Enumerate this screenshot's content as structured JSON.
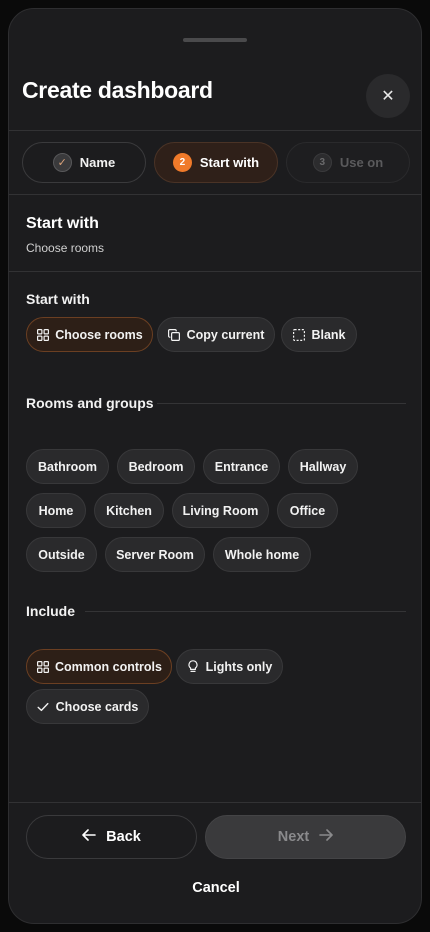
{
  "dialog": {
    "title": "Create dashboard",
    "close_icon": "close-icon"
  },
  "steps": [
    {
      "badge": "✓",
      "label": "Name",
      "state": "done"
    },
    {
      "badge": "2",
      "label": "Start with",
      "state": "active"
    },
    {
      "badge": "3",
      "label": "Use on",
      "state": "disabled"
    }
  ],
  "section": {
    "title": "Start with",
    "subtitle": "Choose rooms"
  },
  "start_with": {
    "label": "Start with",
    "options": [
      {
        "label": "Choose rooms",
        "icon": "grid-icon",
        "selected": true
      },
      {
        "label": "Copy current",
        "icon": "copy-icon",
        "selected": false
      },
      {
        "label": "Blank",
        "icon": "dashed-square-icon",
        "selected": false
      }
    ]
  },
  "rooms": {
    "label": "Rooms and groups",
    "items": [
      "Bathroom",
      "Bedroom",
      "Entrance",
      "Hallway",
      "Home",
      "Kitchen",
      "Living Room",
      "Office",
      "Outside",
      "Server Room",
      "Whole home"
    ]
  },
  "include": {
    "label": "Include",
    "options": [
      {
        "label": "Common controls",
        "icon": "grid-icon",
        "selected": true
      },
      {
        "label": "Lights only",
        "icon": "lightbulb-icon",
        "selected": false
      },
      {
        "label": "Choose cards",
        "icon": "check-icon",
        "selected": false
      }
    ]
  },
  "footer": {
    "back_label": "Back",
    "next_label": "Next",
    "cancel_label": "Cancel",
    "next_enabled": false
  },
  "colors": {
    "accent": "#f07a2a",
    "sheet_bg": "#1c1c1e",
    "chip_bg": "#2a2a2c",
    "selected_chip_bg": "#2d1f17"
  }
}
